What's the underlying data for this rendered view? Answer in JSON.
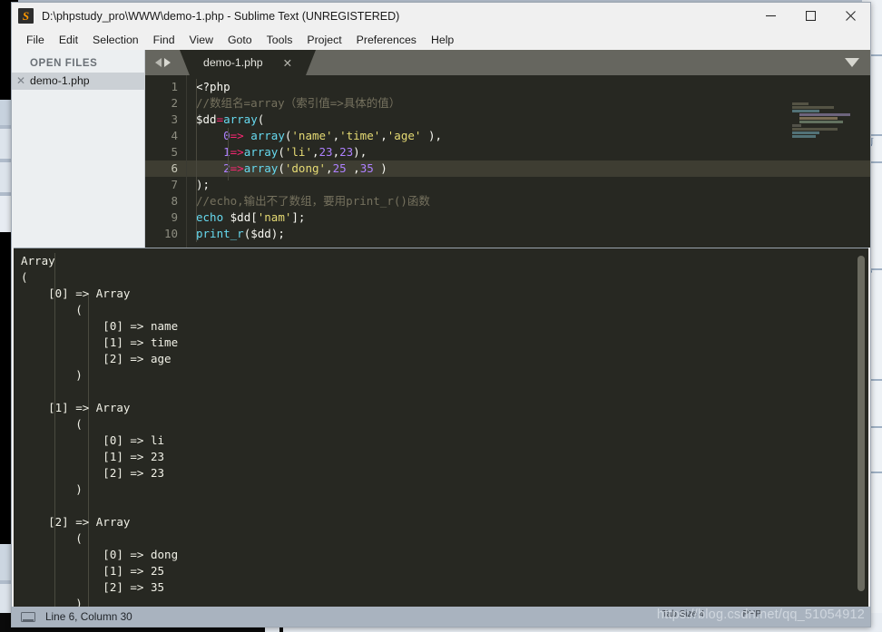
{
  "window": {
    "title": "D:\\phpstudy_pro\\WWW\\demo-1.php - Sublime Text (UNREGISTERED)",
    "app_icon": "sublime-text-logo",
    "controls": {
      "minimize": "—",
      "maximize": "□",
      "close": "✕"
    }
  },
  "menubar": {
    "items": [
      {
        "label": "File"
      },
      {
        "label": "Edit"
      },
      {
        "label": "Selection"
      },
      {
        "label": "Find"
      },
      {
        "label": "View"
      },
      {
        "label": "Goto"
      },
      {
        "label": "Tools"
      },
      {
        "label": "Project"
      },
      {
        "label": "Preferences"
      },
      {
        "label": "Help"
      }
    ]
  },
  "sidebar": {
    "header": "OPEN FILES",
    "files": [
      {
        "name": "demo-1.php",
        "close": "✕"
      }
    ]
  },
  "tabs": {
    "items": [
      {
        "label": "demo-1.php",
        "close": "✕"
      }
    ]
  },
  "editor": {
    "line_numbers": [
      "1",
      "2",
      "3",
      "4",
      "5",
      "6",
      "7",
      "8",
      "9",
      "10"
    ],
    "active_line": 6,
    "lines": [
      "<?php",
      "//数组名=array（索引值=>具体的值）",
      "$dd=array(",
      "    0=> array('name','time','age' ),",
      "    1=>array('li',23,23),",
      "    2=>array('dong',25 ,35 )",
      ");",
      "//echo,输出不了数组，要用print_r()函数",
      "echo $dd['nam'];",
      "print_r($dd);"
    ],
    "colors": {
      "background": "#272822",
      "foreground": "#f8f8f2",
      "comment": "#75715e",
      "string": "#e6db74",
      "number": "#ae81ff",
      "function": "#66d9ef",
      "operator": "#f92672",
      "line_highlight": "#3e3d32",
      "gutter_text": "#8d8d80"
    }
  },
  "console": {
    "output": "Array\n(\n    [0] => Array\n        (\n            [0] => name\n            [1] => time\n            [2] => age\n        )\n\n    [1] => Array\n        (\n            [0] => li\n            [1] => 23\n            [2] => 23\n        )\n\n    [2] => Array\n        (\n            [0] => dong\n            [1] => 25\n            [2] => 35\n        )"
  },
  "statusbar": {
    "icon": "monitor-icon",
    "position": "Line 6, Column 30",
    "watermark": "https://blog.csdn.net/qq_51054912",
    "right_items": [
      "Tab Size 4",
      "PHP"
    ]
  }
}
